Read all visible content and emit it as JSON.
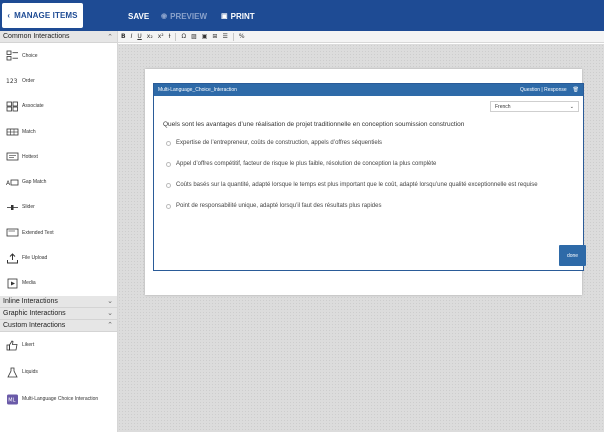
{
  "topbar": {
    "manage_label": "MANAGE ITEMS",
    "save_label": "SAVE",
    "preview_label": "PREVIEW",
    "print_label": "PRINT",
    "bg_color": "#1e4b94"
  },
  "sidebar": {
    "common_header": "Common Interactions",
    "common_items": [
      {
        "label": "Choice",
        "icon": "choice-icon"
      },
      {
        "label": "Order",
        "icon": "order-icon"
      },
      {
        "label": "Associate",
        "icon": "associate-icon"
      },
      {
        "label": "Match",
        "icon": "match-icon"
      },
      {
        "label": "Hottext",
        "icon": "hottext-icon"
      },
      {
        "label": "Gap Match",
        "icon": "gap-match-icon"
      },
      {
        "label": "Slider",
        "icon": "slider-icon"
      },
      {
        "label": "Extended Text",
        "icon": "extended-text-icon"
      },
      {
        "label": "File Upload",
        "icon": "file-upload-icon"
      },
      {
        "label": "Media",
        "icon": "media-icon"
      }
    ],
    "inline_header": "Inline Interactions",
    "graphic_header": "Graphic Interactions",
    "custom_header": "Custom Interactions",
    "custom_items": [
      {
        "label": "Likert",
        "icon": "thumbs-up-icon"
      },
      {
        "label": "Liquids",
        "icon": "flask-icon"
      },
      {
        "label": "Multi-Language Choice Interaction",
        "icon": "multi-language-icon"
      }
    ]
  },
  "editor": {
    "panel_title": "Multi-Language_Choice_Interaction",
    "tabs_label": "Question | Response",
    "language": "French",
    "question": "Quels sont les avantages d’une réalisation de projet traditionnelle en conception soumission construction",
    "choices": [
      "Expertise de l’entrepreneur, coûts de construction, appels d’offres séquentiels",
      "Appel d’offres compétitif, facteur de risque le plus faible, résolution de conception la plus complète",
      "Coûts basés sur la quantité, adapté lorsque le temps est plus important que le coût, adapté lorsqu’une qualité exceptionnelle est requise",
      "Point de responsabilité unique, adapté lorsqu’il faut des résultats plus rapides"
    ],
    "done_label": "done",
    "accent_color": "#2e6aa8"
  }
}
